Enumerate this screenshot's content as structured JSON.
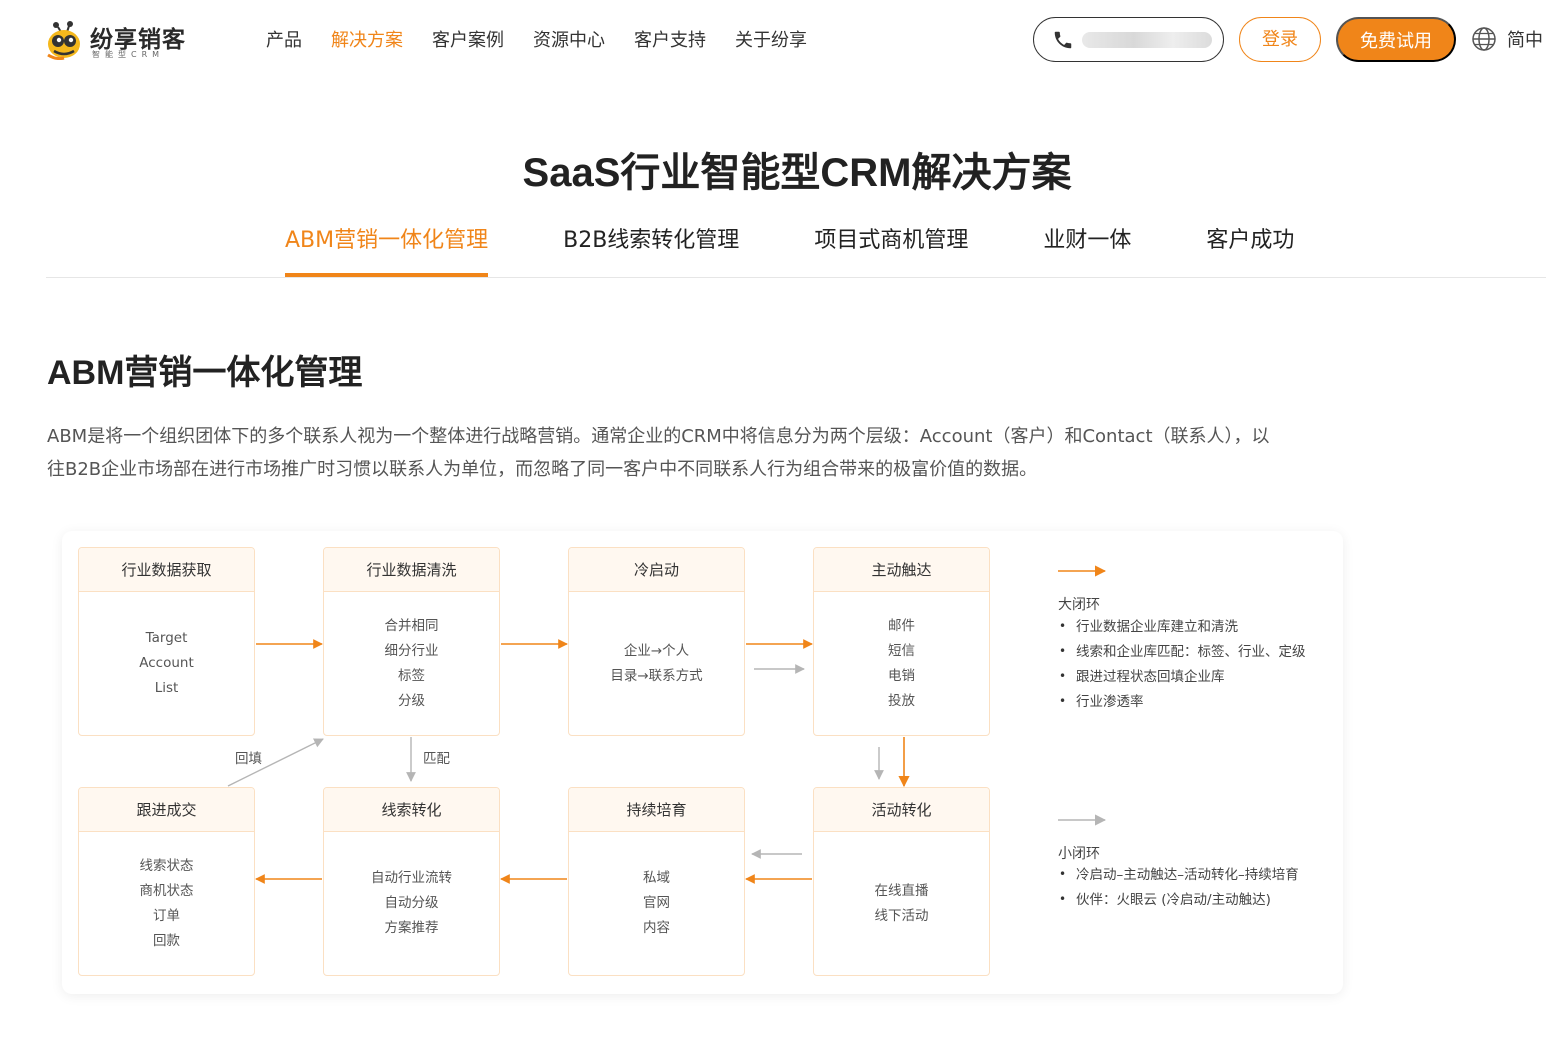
{
  "brand": {
    "name": "纷享销客",
    "tagline": "智能型CRM",
    "accent_color": "#f08519",
    "logo_icon": "bee-icon"
  },
  "nav": {
    "items": [
      {
        "label": "产品",
        "active": false
      },
      {
        "label": "解决方案",
        "active": true
      },
      {
        "label": "客户案例",
        "active": false
      },
      {
        "label": "资源中心",
        "active": false
      },
      {
        "label": "客户支持",
        "active": false
      },
      {
        "label": "关于纷享",
        "active": false
      }
    ]
  },
  "header": {
    "phone_icon": "phone-icon",
    "login_label": "登录",
    "trial_label": "免费试用",
    "lang_icon": "globe-icon",
    "lang_label": "简中"
  },
  "page": {
    "title": "SaaS行业智能型CRM解决方案"
  },
  "tabs": [
    {
      "label": "ABM营销一体化管理",
      "active": true
    },
    {
      "label": "B2B线索转化管理",
      "active": false
    },
    {
      "label": "项目式商机管理",
      "active": false
    },
    {
      "label": "业财一体",
      "active": false
    },
    {
      "label": "客户成功",
      "active": false
    }
  ],
  "section": {
    "heading": "ABM营销一体化管理",
    "description": "ABM是将一个组织团体下的多个联系人视为一个整体进行战略营销。通常企业的CRM中将信息分为两个层级：Account（客户）和Contact（联系人），以往B2B企业市场部在进行市场推广时习惯以联系人为单位，而忽略了同一客户中不同联系人行为组合带来的极富价值的数据。"
  },
  "diagram": {
    "nodes": {
      "data_acquire": {
        "title": "行业数据获取",
        "lines": [
          "Target",
          "Account",
          "List"
        ]
      },
      "data_clean": {
        "title": "行业数据清洗",
        "lines": [
          "合并相同",
          "细分行业",
          "标签",
          "分级"
        ]
      },
      "cold_start": {
        "title": "冷启动",
        "lines": [
          "企业→个人",
          "目录→联系方式"
        ]
      },
      "active_reach": {
        "title": "主动触达",
        "lines": [
          "邮件",
          "短信",
          "电销",
          "投放"
        ]
      },
      "follow_deal": {
        "title": "跟进成交",
        "lines": [
          "线索状态",
          "商机状态",
          "订单",
          "回款"
        ]
      },
      "lead_convert": {
        "title": "线索转化",
        "lines": [
          "自动行业流转",
          "自动分级",
          "方案推荐"
        ]
      },
      "nurture": {
        "title": "持续培育",
        "lines": [
          "私域",
          "官网",
          "内容"
        ]
      },
      "event_convert": {
        "title": "活动转化",
        "lines": [
          "在线直播",
          "线下活动"
        ]
      }
    },
    "edge_labels": {
      "backfill": "回填",
      "match": "匹配"
    },
    "colors": {
      "major_loop": "#f08519",
      "minor_loop": "#b5b5b5"
    },
    "legend": {
      "major_title": "大闭环",
      "major_items": [
        "行业数据企业库建立和清洗",
        "线索和企业库匹配：标签、行业、定级",
        "跟进过程状态回填企业库",
        "行业渗透率"
      ],
      "minor_title": "小闭环",
      "minor_items": [
        "冷启动–主动触达–活动转化–持续培育",
        "伙伴：火眼云 (冷启动/主动触达)"
      ]
    }
  }
}
